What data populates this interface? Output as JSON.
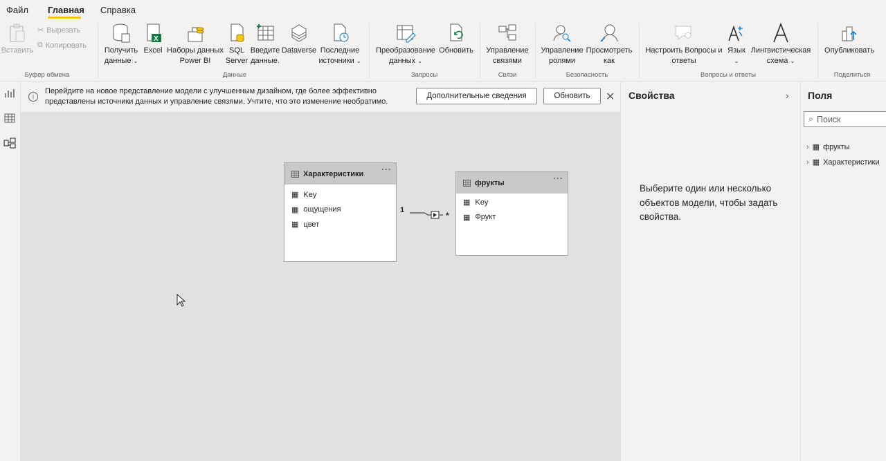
{
  "menu": {
    "file": "Файл",
    "home": "Главная",
    "help": "Справка"
  },
  "ribbon": {
    "clipboard": {
      "paste": "Вставить",
      "cut": "Вырезать",
      "copy": "Копировать",
      "group": "Буфер обмена"
    },
    "data": {
      "get_data_1": "Получить",
      "get_data_2": "данные",
      "excel": "Excel",
      "pbi_1": "Наборы данных",
      "pbi_2": "Power BI",
      "sql_1": "SQL",
      "sql_2": "Server",
      "enter_1": "Введите",
      "enter_2": "данные.",
      "dataverse": "Dataverse",
      "recent_1": "Последние",
      "recent_2": "источники",
      "group": "Данные"
    },
    "queries": {
      "transform_1": "Преобразование",
      "transform_2": "данных",
      "refresh": "Обновить",
      "group": "Запросы"
    },
    "relations": {
      "manage_1": "Управление",
      "manage_2": "связями",
      "group": "Связи"
    },
    "security": {
      "roles_1": "Управление",
      "roles_2": "ролями",
      "viewas_1": "Просмотреть",
      "viewas_2": "как",
      "group": "Безопасность"
    },
    "qa": {
      "setup_1": "Настроить Вопросы и",
      "setup_2": "ответы",
      "lang_1": "Язык",
      "ling_1": "Лингвистическая",
      "ling_2": "схема",
      "group": "Вопросы и ответы"
    },
    "share": {
      "publish": "Опубликовать",
      "group": "Поделиться"
    }
  },
  "banner": {
    "text": "Перейдите на новое представление модели с улучшенным дизайном, где более эффективно представлены источники данных и управление связями. Учтите, что это изменение необратимо.",
    "more_info": "Дополнительные сведения",
    "update": "Обновить"
  },
  "diagram": {
    "table1": {
      "name": "Характеристики",
      "fields": [
        "Key",
        "ощущения",
        "цвет"
      ]
    },
    "table2": {
      "name": "фрукты",
      "fields": [
        "Key",
        "Фрукт"
      ]
    },
    "rel_one": "1",
    "rel_many": "*"
  },
  "properties": {
    "title": "Свойства",
    "hint": "Выберите один или несколько объектов модели, чтобы задать свойства."
  },
  "fields_pane": {
    "title": "Поля",
    "search_placeholder": "Поиск",
    "items": [
      "фрукты",
      "Характеристики"
    ]
  },
  "colors": {
    "accent": "#f2c811",
    "canvas": "#e1e1e1",
    "table_header": "#c8c8c8"
  }
}
